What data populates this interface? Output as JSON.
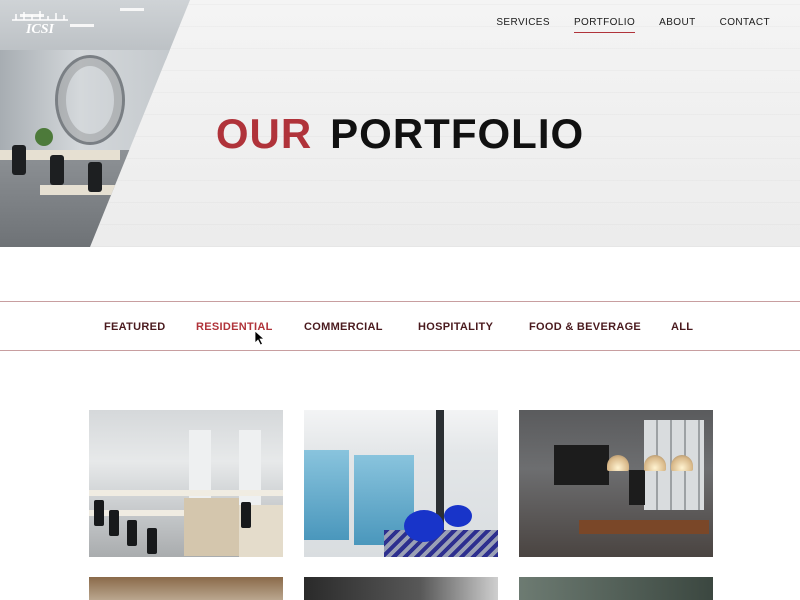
{
  "brand": {
    "logo_text": "ICSI"
  },
  "nav": {
    "items": [
      {
        "label": "SERVICES"
      },
      {
        "label": "PORTFOLIO"
      },
      {
        "label": "ABOUT"
      },
      {
        "label": "CONTACT"
      }
    ],
    "active": "PORTFOLIO"
  },
  "hero": {
    "title_accent": "OUR",
    "title_rest": "PORTFOLIO"
  },
  "filters": {
    "tabs": [
      {
        "label": "FEATURED"
      },
      {
        "label": "RESIDENTIAL"
      },
      {
        "label": "COMMERCIAL"
      },
      {
        "label": "HOSPITALITY"
      },
      {
        "label": "FOOD & BEVERAGE"
      },
      {
        "label": "ALL"
      }
    ],
    "active": "RESIDENTIAL"
  },
  "gallery": {
    "items": [
      {
        "subject": "open-plan office interior"
      },
      {
        "subject": "office lobby with blue chairs"
      },
      {
        "subject": "restaurant dining room"
      },
      {
        "subject": "building facade"
      },
      {
        "subject": "dark interior"
      },
      {
        "subject": "glass facade"
      }
    ]
  },
  "colors": {
    "accent": "#b0333a",
    "tab_text": "#4a1a1e",
    "divider": "#c89ea0"
  }
}
